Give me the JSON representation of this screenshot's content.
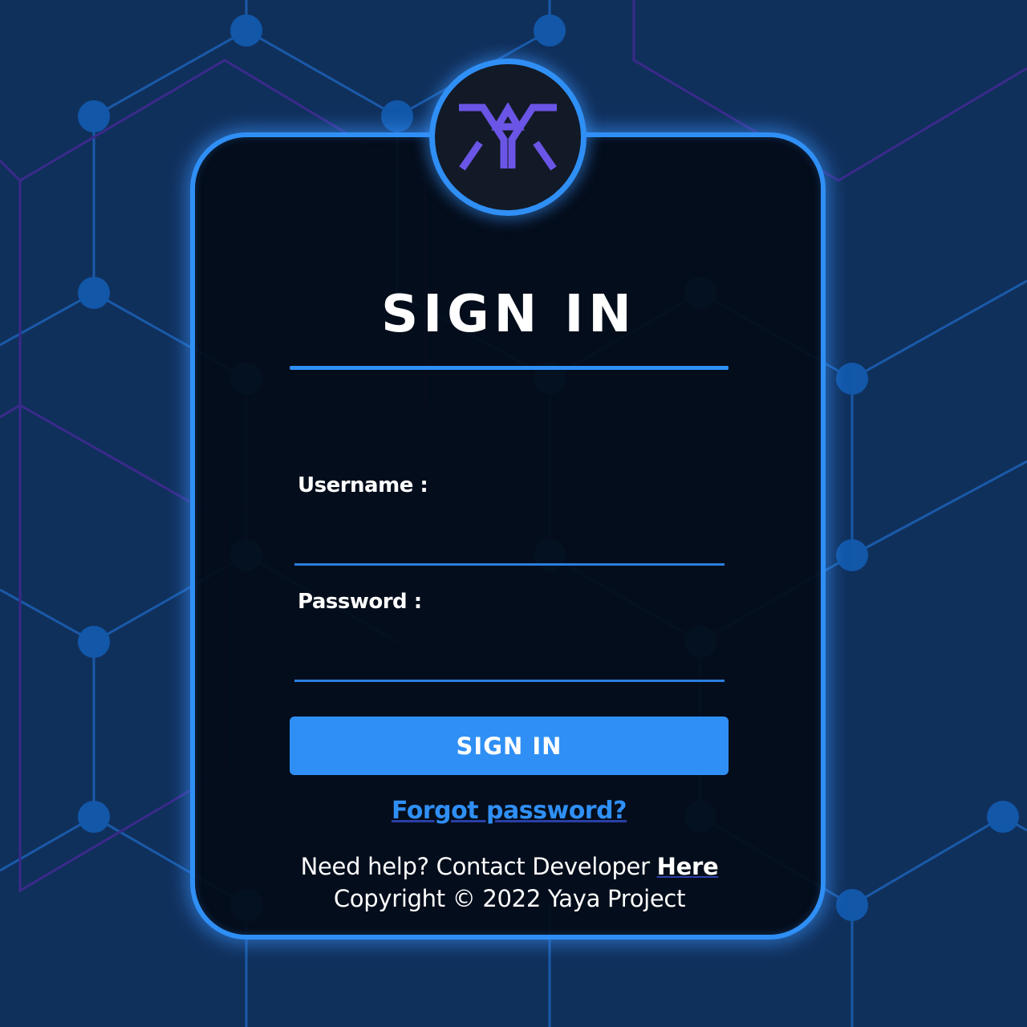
{
  "colors": {
    "background": "#10305c",
    "accent": "#2f8ff5",
    "card": "#030b16",
    "logo_purple": "#6a55e6",
    "text": "#ffffff"
  },
  "logo": {
    "icon": "yaya-logo-icon"
  },
  "form": {
    "title": "SIGN IN",
    "username_label": "Username :",
    "username_value": "",
    "password_label": "Password :",
    "password_value": "",
    "submit_label": "SIGN IN",
    "forgot_label": "Forgot password?"
  },
  "footer": {
    "help_text": "Need help? Contact Developer ",
    "help_link": "Here",
    "copyright": "Copyright © 2022 Yaya Project"
  }
}
